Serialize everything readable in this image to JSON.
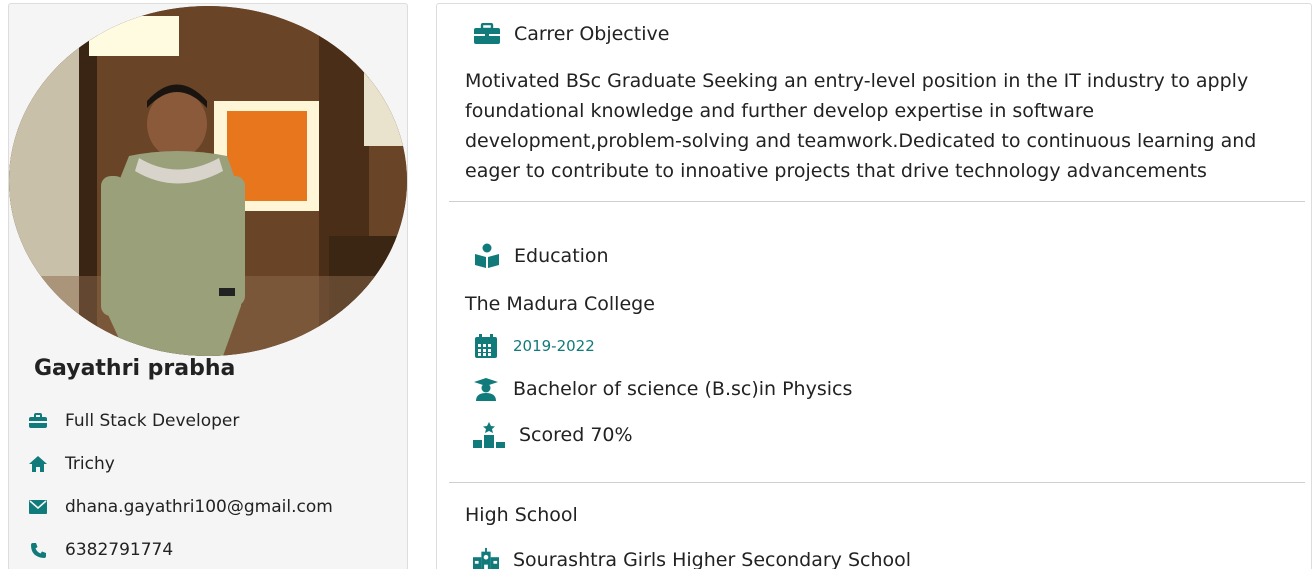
{
  "colors": {
    "accent": "#117a7a",
    "text": "#222222",
    "sidebar_bg": "#f5f5f5",
    "divider": "#cfcfcf"
  },
  "profile": {
    "name": "Gayathri prabha",
    "role": "Full Stack Developer",
    "location": "Trichy",
    "email": "dhana.gayathri100@gmail.com",
    "phone": "6382791774",
    "icons": [
      "briefcase-icon",
      "home-icon",
      "envelope-icon",
      "phone-icon"
    ]
  },
  "objective": {
    "title": "Carrer Objective",
    "text": "Motivated BSc Graduate Seeking an entry-level position in the IT industry to apply foundational knowledge and further develop expertise in software development,problem-solving and teamwork.Dedicated to continuous learning and eager to contribute to innoative projects that drive technology advancements"
  },
  "education": {
    "title": "Education",
    "college": {
      "name": "The Madura College",
      "years": "2019-2022",
      "degree": "Bachelor of science (B.sc)in Physics",
      "score": "Scored 70%"
    },
    "high_school": {
      "label": "High School",
      "name": "Sourashtra Girls Higher Secondary School"
    }
  }
}
